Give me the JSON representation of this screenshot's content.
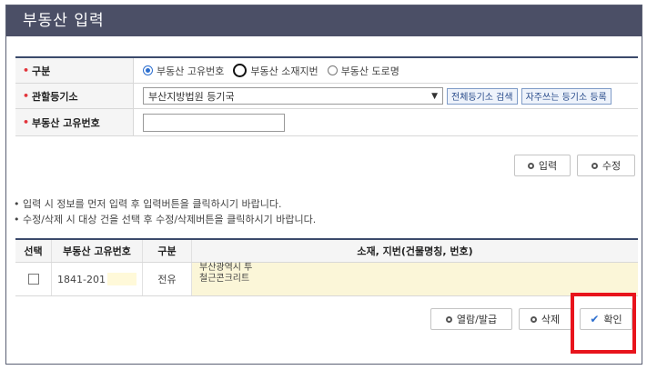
{
  "window": {
    "title": "부동산 입력"
  },
  "form": {
    "type": {
      "label": "구분",
      "options": [
        "부동산 고유번호",
        "부동산 소재지번",
        "부동산 도로명"
      ],
      "selected": "부동산 고유번호"
    },
    "registry": {
      "label": "관할등기소",
      "selected_value": "부산지방법원 등기국",
      "search_all_label": "전체등기소 검색",
      "favorite_register_label": "자주쓰는 등기소 등록"
    },
    "unique_no": {
      "label": "부동산 고유번호",
      "value": ""
    }
  },
  "actions": {
    "input_label": "입력",
    "edit_label": "수정"
  },
  "notes": [
    "• 입력 시 정보를 먼저 입력 후 입력버튼을 클릭하시기 바랍니다.",
    "• 수정/삭제 시 대상 건을 선택 후 수정/삭제버튼을 클릭하시기 바랍니다."
  ],
  "table": {
    "headers": [
      "선택",
      "부동산 고유번호",
      "구분",
      "소재, 지번(건물명칭, 번호)"
    ],
    "rows": [
      {
        "unique_no": "1841-201",
        "type": "전유",
        "address_line1": "부산광역시 투",
        "address_line2": "철근콘크리트"
      }
    ]
  },
  "bottom_actions": {
    "view_issue_label": "열람/발급",
    "delete_label": "삭제",
    "confirm_label": "확인"
  },
  "colors": {
    "title_bar": "#4b4f66",
    "accent": "#2d6fcf",
    "highlight": "#e8141c"
  }
}
